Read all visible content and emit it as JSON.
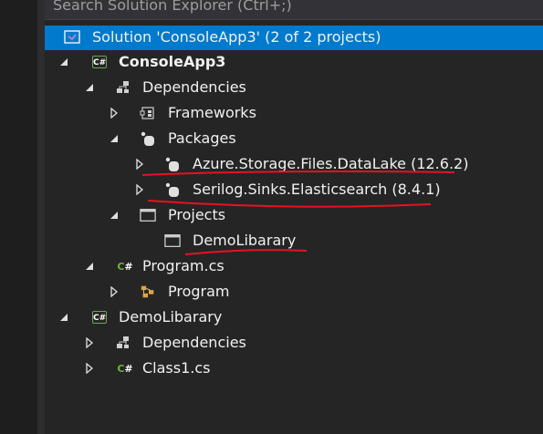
{
  "search": {
    "placeholder": "Search Solution Explorer (Ctrl+;)"
  },
  "tree": {
    "solution": "Solution 'ConsoleApp3' (2 of 2 projects)",
    "project1": "ConsoleApp3",
    "dependencies1": "Dependencies",
    "frameworks": "Frameworks",
    "packages": "Packages",
    "pkg1": "Azure.Storage.Files.DataLake (12.6.2)",
    "pkg2": "Serilog.Sinks.Elasticsearch (8.4.1)",
    "projects": "Projects",
    "demoref": "DemoLibarary",
    "programcs": "Program.cs",
    "program": "Program",
    "project2": "DemoLibarary",
    "dependencies2": "Dependencies",
    "class1": "Class1.cs"
  },
  "colors": {
    "background": "#252526",
    "selection": "#007acc",
    "annotation": "#e81123"
  }
}
